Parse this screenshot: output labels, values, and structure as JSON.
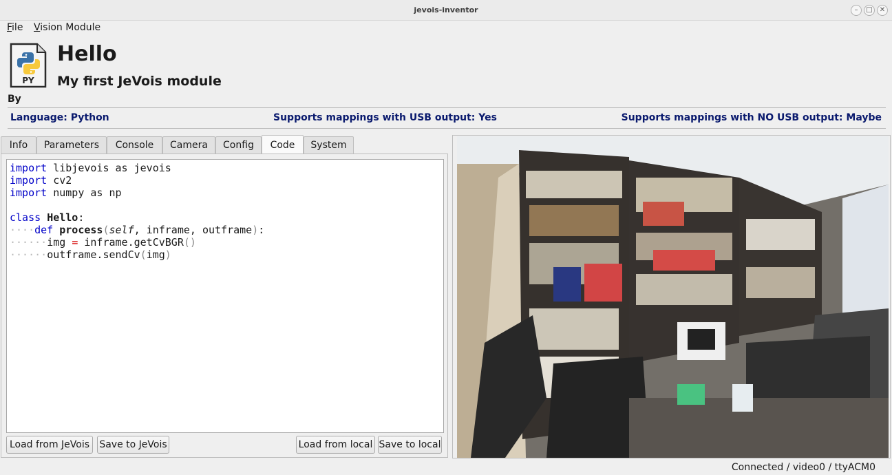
{
  "window": {
    "title": "jevois-inventor",
    "minimize_glyph": "–",
    "maximize_glyph": "□",
    "close_glyph": "✕"
  },
  "menu": {
    "file": {
      "accel": "F",
      "rest": "ile"
    },
    "vision_module": {
      "accel": "V",
      "rest": "ision Module"
    }
  },
  "module": {
    "icon_label": "PY",
    "icon": "python-file-icon",
    "title": "Hello",
    "subtitle": "My first JeVois module",
    "by": "By",
    "language": "Language: Python",
    "usb_output": "Supports mappings with USB output: Yes",
    "no_usb_output": "Supports mappings with NO USB output: Maybe"
  },
  "tabs": [
    {
      "label": "Info"
    },
    {
      "label": "Parameters"
    },
    {
      "label": "Console"
    },
    {
      "label": "Camera"
    },
    {
      "label": "Config"
    },
    {
      "label": "Code",
      "active": true
    },
    {
      "label": "System"
    }
  ],
  "code_tokens": {
    "import": "import",
    "as": "as",
    "class": "class",
    "def": "def",
    "libjevois": "libjevois",
    "jevois": "jevois",
    "cv2": "cv2",
    "numpy": "numpy",
    "np": "np",
    "Hello": "Hello",
    "process": "process",
    "self": "self",
    "inframe": "inframe",
    "outframe": "outframe",
    "img": "img",
    "eq": "=",
    "getCvBGR": "inframe.getCvBGR",
    "sendCv": "outframe.sendCv",
    "colon": ":",
    "comma": ",",
    "lparen": "(",
    "rparen": ")",
    "parens": "()",
    "ws1": "····",
    "ws2": "······"
  },
  "buttons": {
    "load_jevois": "Load from JeVois",
    "save_jevois": "Save to JeVois",
    "load_local": "Load from local",
    "save_local": "Save to local"
  },
  "status": {
    "text": "Connected / video0 / ttyACM0"
  },
  "colors": {
    "keyword": "#0000c8",
    "info_text": "#0a1a6e",
    "python_blue": "#3a72a8",
    "python_yellow": "#f7c93c"
  }
}
